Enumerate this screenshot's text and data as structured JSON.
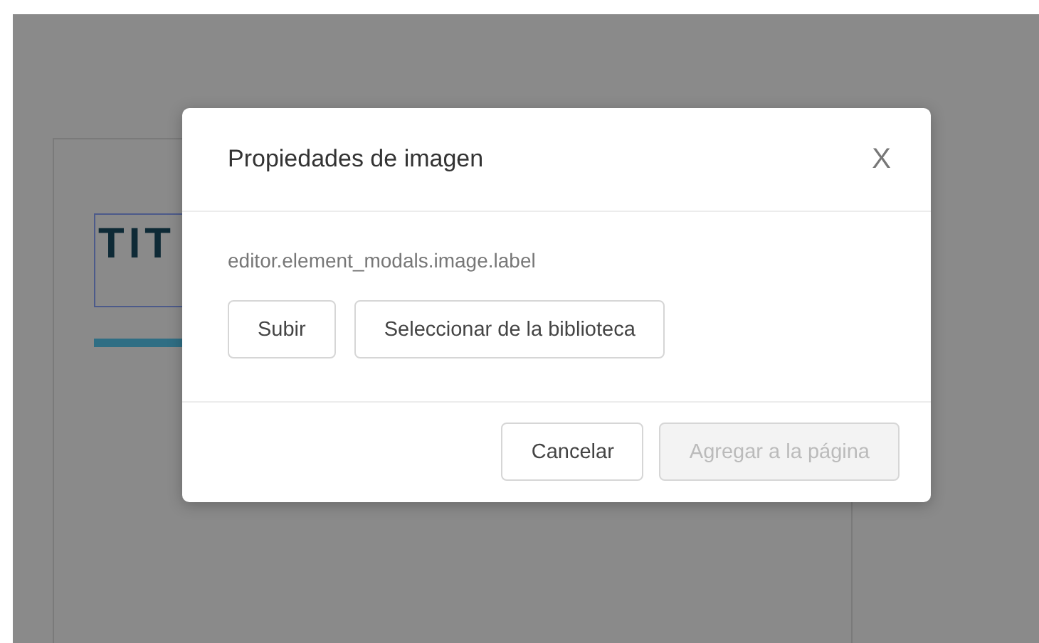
{
  "background_page": {
    "heading": "TIT"
  },
  "modal": {
    "title": "Propiedades de imagen",
    "close": "X",
    "label": "editor.element_modals.image.label",
    "source_buttons": [
      {
        "label": "Subir"
      },
      {
        "label": "Seleccionar de la biblioteca"
      }
    ],
    "footer_buttons": [
      {
        "label": "Cancelar",
        "disabled": false
      },
      {
        "label": "Agregar a la página",
        "disabled": true
      }
    ]
  }
}
